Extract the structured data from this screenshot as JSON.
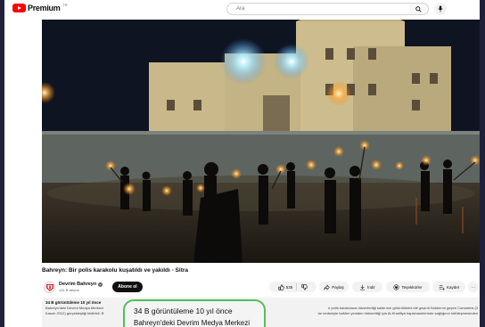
{
  "header": {
    "logo_text": "Premium",
    "logo_sup": "TR",
    "search_placeholder": "Ara"
  },
  "video": {
    "title": "Bahreyn: Bir polis karakolu kuşatıldı ve yakıldı - Sitra"
  },
  "channel": {
    "name": "Devrim Bahreyn",
    "subscribers": "131 B abone",
    "subscribe_label": "Abone ol"
  },
  "actions": {
    "like_count": "535",
    "share_label": "Paylaş",
    "download_label": "İndir",
    "thanks_label": "Teşekkürler",
    "save_label": "Kaydet",
    "more_label": "···"
  },
  "description": {
    "meta": "34 B görüntüleme  10 yıl önce",
    "line1": "Bahreyn'deki Devrim Medya Merkezi",
    "line1_tail": "ır polis karakoluna düzenlediği saldırının görüntülerini ele geçirdi.Saldırının geçen Cumartesi (3",
    "line2_head": "Kasım 2012) gerçekleştiği bildirildi. B",
    "line2_tail": "lar nedeniyle kaMeri yeniden hükmettiği için Al-Khalifiya hapishanelerinde sağlığının kötüleşmesinden"
  },
  "zoom": {
    "meta": "34 B görüntüleme  10 yıl önce",
    "text": "Bahreyn'deki Devrim Medya Merkezi"
  },
  "colors": {
    "brand_red": "#ff0000",
    "highlight_border": "#52c05a",
    "frame": "#20203a"
  }
}
